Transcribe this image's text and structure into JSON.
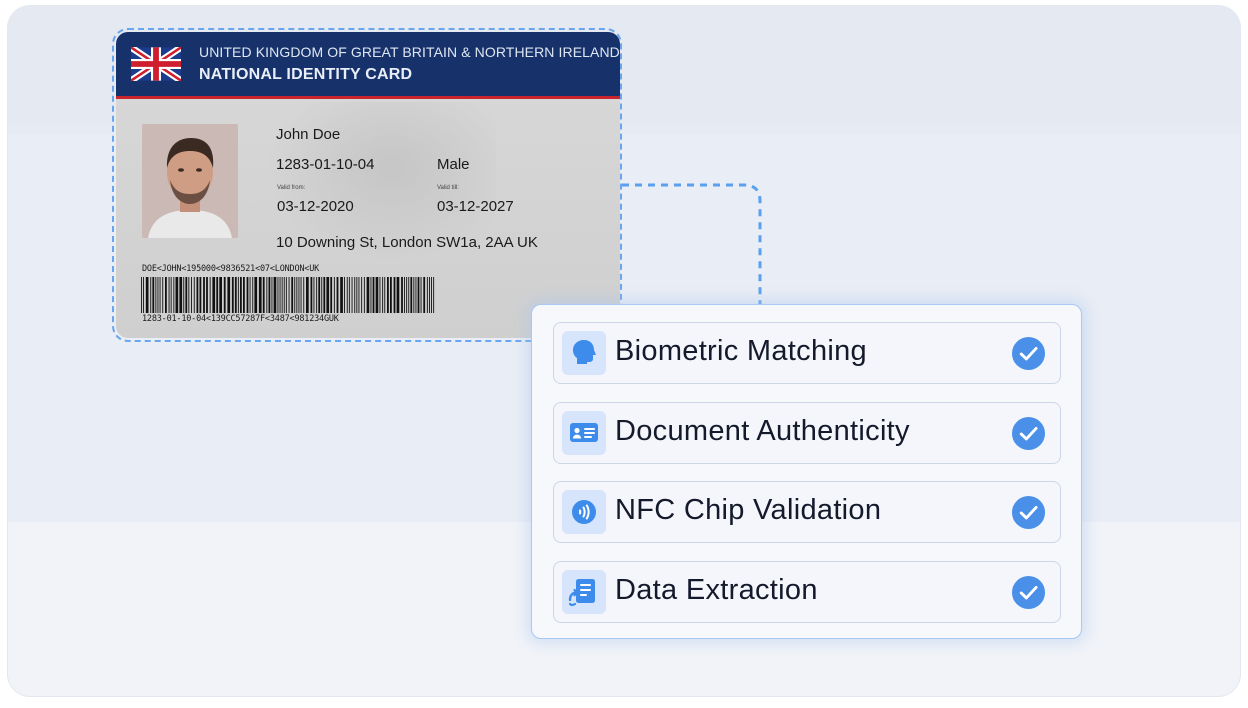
{
  "id_card": {
    "country": "UNITED KINGDOM OF GREAT BRITAIN & NORTHERN IRELAND",
    "card_type": "NATIONAL IDENTITY CARD",
    "flag_icon": "union-jack-flag",
    "name": "John Doe",
    "id_number": "1283-01-10-04",
    "sex": "Male",
    "valid_from_label": "Valid from:",
    "valid_from": "03-12-2020",
    "valid_till_label": "Valid till:",
    "valid_till": "03-12-2027",
    "address": "10 Downing St, London SW1a, 2AA UK",
    "mrz_line1": "DOE<JOHN<195000<9836521<07<LONDON<UK",
    "mrz_line2": "1283-01-10-04<139CC57287F<3487<981234GUK"
  },
  "checks": [
    {
      "label": "Biometric Matching",
      "icon": "head-profile-icon",
      "status": "check-icon"
    },
    {
      "label": "Document Authenticity",
      "icon": "id-card-icon",
      "status": "check-icon"
    },
    {
      "label": "NFC Chip Validation",
      "icon": "nfc-icon",
      "status": "check-icon"
    },
    {
      "label": "Data Extraction",
      "icon": "document-extract-icon",
      "status": "check-icon"
    }
  ],
  "colors": {
    "card_header": "#17326a",
    "card_stripe": "#c9252f",
    "accent": "#4a90e8",
    "icon_bg": "#d6e5fb"
  }
}
